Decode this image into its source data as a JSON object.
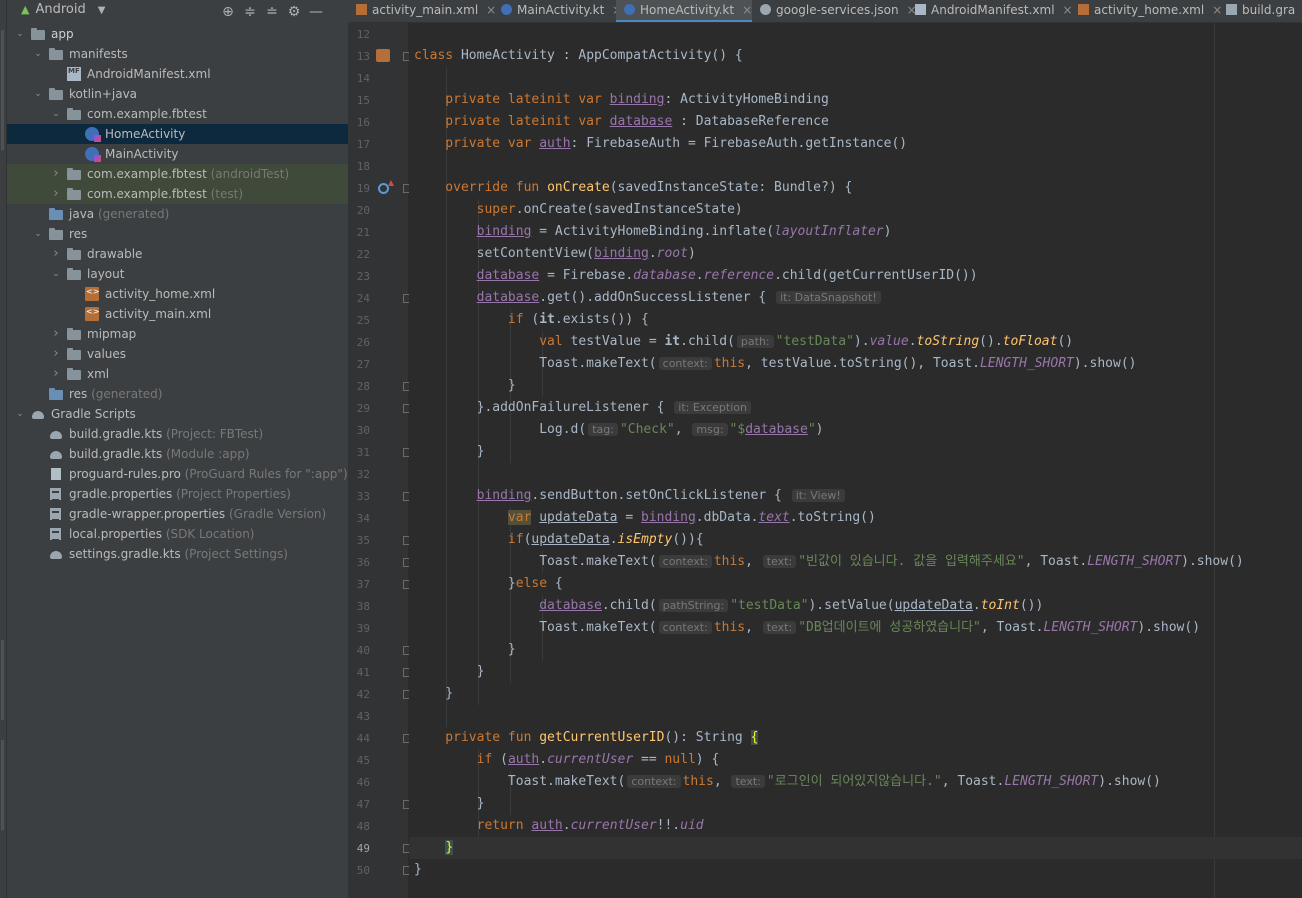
{
  "project_panel": {
    "view_title": "Android",
    "toolbar_icons": [
      "crosshair-icon",
      "expand-all-icon",
      "collapse-all-icon",
      "gear-icon",
      "minimize-icon"
    ],
    "tree": [
      {
        "label": "app",
        "hint": "",
        "depth": 0,
        "icon": "module-folder",
        "expanded": true,
        "bold": true
      },
      {
        "label": "manifests",
        "hint": "",
        "depth": 1,
        "icon": "folder",
        "expanded": true
      },
      {
        "label": "AndroidManifest.xml",
        "hint": "",
        "depth": 2,
        "icon": "manifest-file",
        "leaf": true
      },
      {
        "label": "kotlin+java",
        "hint": "",
        "depth": 1,
        "icon": "folder",
        "expanded": true
      },
      {
        "label": "com.example.fbtest",
        "hint": "",
        "depth": 2,
        "icon": "package",
        "expanded": true
      },
      {
        "label": "HomeActivity",
        "hint": "",
        "depth": 3,
        "icon": "kotlin-class",
        "leaf": true,
        "selected": true
      },
      {
        "label": "MainActivity",
        "hint": "",
        "depth": 3,
        "icon": "kotlin-class",
        "leaf": true
      },
      {
        "label": "com.example.fbtest",
        "hint": "(androidTest)",
        "depth": 2,
        "icon": "package",
        "expanded": false,
        "tinted": true
      },
      {
        "label": "com.example.fbtest",
        "hint": "(test)",
        "depth": 2,
        "icon": "package",
        "expanded": false,
        "tinted": true
      },
      {
        "label": "java",
        "hint": "(generated)",
        "depth": 1,
        "icon": "generated-folder",
        "leaf": true
      },
      {
        "label": "res",
        "hint": "",
        "depth": 1,
        "icon": "folder",
        "expanded": true
      },
      {
        "label": "drawable",
        "hint": "",
        "depth": 2,
        "icon": "folder",
        "expanded": false
      },
      {
        "label": "layout",
        "hint": "",
        "depth": 2,
        "icon": "folder",
        "expanded": true
      },
      {
        "label": "activity_home.xml",
        "hint": "",
        "depth": 3,
        "icon": "layout-xml",
        "leaf": true
      },
      {
        "label": "activity_main.xml",
        "hint": "",
        "depth": 3,
        "icon": "layout-xml",
        "leaf": true
      },
      {
        "label": "mipmap",
        "hint": "",
        "depth": 2,
        "icon": "folder",
        "expanded": false
      },
      {
        "label": "values",
        "hint": "",
        "depth": 2,
        "icon": "folder",
        "expanded": false
      },
      {
        "label": "xml",
        "hint": "",
        "depth": 2,
        "icon": "folder",
        "expanded": false
      },
      {
        "label": "res",
        "hint": "(generated)",
        "depth": 1,
        "icon": "generated-folder",
        "leaf": true
      },
      {
        "label": "Gradle Scripts",
        "hint": "",
        "depth": 0,
        "icon": "gradle",
        "expanded": true
      },
      {
        "label": "build.gradle.kts",
        "hint": "(Project: FBTest)",
        "depth": 1,
        "icon": "gradle",
        "leaf": true
      },
      {
        "label": "build.gradle.kts",
        "hint": "(Module :app)",
        "depth": 1,
        "icon": "gradle",
        "leaf": true
      },
      {
        "label": "proguard-rules.pro",
        "hint": "(ProGuard Rules for \":app\")",
        "depth": 1,
        "icon": "file",
        "leaf": true
      },
      {
        "label": "gradle.properties",
        "hint": "(Project Properties)",
        "depth": 1,
        "icon": "properties",
        "leaf": true
      },
      {
        "label": "gradle-wrapper.properties",
        "hint": "(Gradle Version)",
        "depth": 1,
        "icon": "properties",
        "leaf": true
      },
      {
        "label": "local.properties",
        "hint": "(SDK Location)",
        "depth": 1,
        "icon": "properties",
        "leaf": true
      },
      {
        "label": "settings.gradle.kts",
        "hint": "(Project Settings)",
        "depth": 1,
        "icon": "gradle",
        "leaf": true
      }
    ]
  },
  "tabs": [
    {
      "label": "activity_main.xml",
      "icon": "xml",
      "active": false,
      "closable": true
    },
    {
      "label": "MainActivity.kt",
      "icon": "kt",
      "active": false,
      "closable": true
    },
    {
      "label": "HomeActivity.kt",
      "icon": "kt",
      "active": true,
      "closable": true
    },
    {
      "label": "google-services.json",
      "icon": "json",
      "active": false,
      "closable": true
    },
    {
      "label": "AndroidManifest.xml",
      "icon": "mf",
      "active": false,
      "closable": true
    },
    {
      "label": "activity_home.xml",
      "icon": "xml",
      "active": false,
      "closable": true
    },
    {
      "label": "build.gra",
      "icon": "gr",
      "active": false,
      "closable": false
    }
  ],
  "editor": {
    "current_line": 49,
    "lines": [
      {
        "n": 12,
        "t": []
      },
      {
        "n": 13,
        "t": [
          [
            "class ",
            "k"
          ],
          [
            "HomeActivity : AppCompatActivity() {",
            ""
          ]
        ]
      },
      {
        "n": 14,
        "t": []
      },
      {
        "n": 15,
        "t": [
          [
            "    private lateinit var ",
            "k"
          ],
          [
            "binding",
            "pu"
          ],
          [
            ": ActivityHomeBinding",
            ""
          ]
        ]
      },
      {
        "n": 16,
        "t": [
          [
            "    private lateinit var ",
            "k"
          ],
          [
            "database",
            "pu"
          ],
          [
            " : DatabaseReference",
            ""
          ]
        ]
      },
      {
        "n": 17,
        "t": [
          [
            "    private var ",
            "k"
          ],
          [
            "auth",
            "pu"
          ],
          [
            ": FirebaseAuth = FirebaseAuth.getInstance()",
            ""
          ]
        ]
      },
      {
        "n": 18,
        "t": []
      },
      {
        "n": 19,
        "t": [
          [
            "    override fun ",
            "k"
          ],
          [
            "onCreate",
            "f"
          ],
          [
            "(savedInstanceState: Bundle?) {",
            ""
          ]
        ]
      },
      {
        "n": 20,
        "t": [
          [
            "        ",
            ""
          ],
          [
            "super",
            "k"
          ],
          [
            ".onCreate(savedInstanceState)",
            ""
          ]
        ]
      },
      {
        "n": 21,
        "t": [
          [
            "        ",
            ""
          ],
          [
            "binding",
            "pu"
          ],
          [
            " = ActivityHomeBinding.inflate(",
            ""
          ],
          [
            "layoutInflater",
            "pi"
          ],
          [
            ")",
            ""
          ]
        ]
      },
      {
        "n": 22,
        "t": [
          [
            "        setContentView(",
            ""
          ],
          [
            "binding",
            "pu"
          ],
          [
            ".",
            ""
          ],
          [
            "root",
            "pi"
          ],
          [
            ")",
            ""
          ]
        ]
      },
      {
        "n": 23,
        "t": [
          [
            "        ",
            ""
          ],
          [
            "database",
            "pu"
          ],
          [
            " = Firebase.",
            ""
          ],
          [
            "database",
            "pi"
          ],
          [
            ".",
            ""
          ],
          [
            "reference",
            "pi"
          ],
          [
            ".child(getCurrentUserID())",
            ""
          ]
        ]
      },
      {
        "n": 24,
        "t": [
          [
            "        ",
            ""
          ],
          [
            "database",
            "pu"
          ],
          [
            ".get().addOnSuccessListener { ",
            ""
          ],
          [
            "it: DataSnapshot!",
            "h"
          ]
        ]
      },
      {
        "n": 25,
        "t": [
          [
            "            ",
            ""
          ],
          [
            "if ",
            "k"
          ],
          [
            "(",
            ""
          ],
          [
            "it",
            "b"
          ],
          [
            ".exists()) {",
            ""
          ]
        ]
      },
      {
        "n": 26,
        "t": [
          [
            "                ",
            ""
          ],
          [
            "val ",
            "k"
          ],
          [
            "testValue = ",
            ""
          ],
          [
            "it",
            "b"
          ],
          [
            ".child(",
            ""
          ],
          [
            "path:",
            "h"
          ],
          [
            "\"testData\"",
            "s"
          ],
          [
            ").",
            ""
          ],
          [
            "value",
            "pi"
          ],
          [
            ".",
            ""
          ],
          [
            "toString",
            "fi"
          ],
          [
            "().",
            ""
          ],
          [
            "toFloat",
            "fi"
          ],
          [
            "()",
            ""
          ]
        ]
      },
      {
        "n": 27,
        "t": [
          [
            "                Toast.makeText(",
            ""
          ],
          [
            "context:",
            "h"
          ],
          [
            "this",
            "k"
          ],
          [
            ", testValue.toString(), Toast.",
            ""
          ],
          [
            "LENGTH_SHORT",
            "pi"
          ],
          [
            ").show()",
            ""
          ]
        ]
      },
      {
        "n": 28,
        "t": [
          [
            "            }",
            ""
          ]
        ]
      },
      {
        "n": 29,
        "t": [
          [
            "        }.addOnFailureListener { ",
            ""
          ],
          [
            "it: Exception",
            "h"
          ]
        ]
      },
      {
        "n": 30,
        "t": [
          [
            "                Log.d(",
            ""
          ],
          [
            "tag:",
            "h"
          ],
          [
            "\"Check\"",
            "s"
          ],
          [
            ", ",
            ""
          ],
          [
            "msg:",
            "h"
          ],
          [
            "\"$",
            "s"
          ],
          [
            "database",
            "pu"
          ],
          [
            "\"",
            "s"
          ],
          [
            ")",
            ""
          ]
        ]
      },
      {
        "n": 31,
        "t": [
          [
            "        }",
            ""
          ]
        ]
      },
      {
        "n": 32,
        "t": []
      },
      {
        "n": 33,
        "t": [
          [
            "        ",
            ""
          ],
          [
            "binding",
            "pu"
          ],
          [
            ".sendButton.setOnClickListener { ",
            ""
          ],
          [
            "it: View!",
            "h"
          ]
        ]
      },
      {
        "n": 34,
        "t": [
          [
            "            ",
            ""
          ],
          [
            "var",
            "kw"
          ],
          [
            " ",
            ""
          ],
          [
            "updateData",
            "u"
          ],
          [
            " = ",
            ""
          ],
          [
            "binding",
            "pu"
          ],
          [
            ".dbData.",
            ""
          ],
          [
            "text",
            "pui"
          ],
          [
            ".toString()",
            ""
          ]
        ]
      },
      {
        "n": 35,
        "t": [
          [
            "            ",
            ""
          ],
          [
            "if",
            "k"
          ],
          [
            "(",
            ""
          ],
          [
            "updateData",
            "u"
          ],
          [
            ".",
            ""
          ],
          [
            "isEmpty",
            "fi"
          ],
          [
            "()){",
            ""
          ]
        ]
      },
      {
        "n": 36,
        "t": [
          [
            "                Toast.makeText(",
            ""
          ],
          [
            "context:",
            "h"
          ],
          [
            "this",
            "k"
          ],
          [
            ", ",
            ""
          ],
          [
            "text:",
            "h"
          ],
          [
            "\"빈값이 있습니다. 값을 입력해주세요\"",
            "s"
          ],
          [
            ", Toast.",
            ""
          ],
          [
            "LENGTH_SHORT",
            "pi"
          ],
          [
            ").show()",
            ""
          ]
        ]
      },
      {
        "n": 37,
        "t": [
          [
            "            }",
            ""
          ],
          [
            "else ",
            "k"
          ],
          [
            "{",
            ""
          ]
        ]
      },
      {
        "n": 38,
        "t": [
          [
            "                ",
            ""
          ],
          [
            "database",
            "pu"
          ],
          [
            ".child(",
            ""
          ],
          [
            "pathString:",
            "h"
          ],
          [
            "\"testData\"",
            "s"
          ],
          [
            ").setValue(",
            ""
          ],
          [
            "updateData",
            "u"
          ],
          [
            ".",
            ""
          ],
          [
            "toInt",
            "fi"
          ],
          [
            "())",
            ""
          ]
        ]
      },
      {
        "n": 39,
        "t": [
          [
            "                Toast.makeText(",
            ""
          ],
          [
            "context:",
            "h"
          ],
          [
            "this",
            "k"
          ],
          [
            ", ",
            ""
          ],
          [
            "text:",
            "h"
          ],
          [
            "\"DB업데이트에 성공하였습니다\"",
            "s"
          ],
          [
            ", Toast.",
            ""
          ],
          [
            "LENGTH_SHORT",
            "pi"
          ],
          [
            ").show()",
            ""
          ]
        ]
      },
      {
        "n": 40,
        "t": [
          [
            "            }",
            ""
          ]
        ]
      },
      {
        "n": 41,
        "t": [
          [
            "        }",
            ""
          ]
        ]
      },
      {
        "n": 42,
        "t": [
          [
            "    }",
            ""
          ]
        ]
      },
      {
        "n": 43,
        "t": []
      },
      {
        "n": 44,
        "t": [
          [
            "    private fun ",
            "k"
          ],
          [
            "getCurrentUserID",
            "f"
          ],
          [
            "(): String ",
            ""
          ],
          [
            "{",
            "bh"
          ]
        ]
      },
      {
        "n": 45,
        "t": [
          [
            "        ",
            ""
          ],
          [
            "if ",
            "k"
          ],
          [
            "(",
            ""
          ],
          [
            "auth",
            "pu"
          ],
          [
            ".",
            ""
          ],
          [
            "currentUser",
            "pi"
          ],
          [
            " == ",
            ""
          ],
          [
            "null",
            "k"
          ],
          [
            ") {",
            ""
          ]
        ]
      },
      {
        "n": 46,
        "t": [
          [
            "            Toast.makeText(",
            ""
          ],
          [
            "context:",
            "h"
          ],
          [
            "this",
            "k"
          ],
          [
            ", ",
            ""
          ],
          [
            "text:",
            "h"
          ],
          [
            "\"로그인이 되어있지않습니다.\"",
            "s"
          ],
          [
            ", Toast.",
            ""
          ],
          [
            "LENGTH_SHORT",
            "pi"
          ],
          [
            ").show()",
            ""
          ]
        ]
      },
      {
        "n": 47,
        "t": [
          [
            "        }",
            ""
          ]
        ]
      },
      {
        "n": 48,
        "t": [
          [
            "        ",
            ""
          ],
          [
            "return ",
            "k"
          ],
          [
            "auth",
            "pu"
          ],
          [
            ".",
            ""
          ],
          [
            "currentUser",
            "pi"
          ],
          [
            "!!.",
            ""
          ],
          [
            "uid",
            "pi"
          ]
        ]
      },
      {
        "n": 49,
        "t": [
          [
            "    ",
            ""
          ],
          [
            "}",
            "bh"
          ]
        ]
      },
      {
        "n": 50,
        "t": [
          [
            "}",
            ""
          ]
        ]
      }
    ]
  }
}
